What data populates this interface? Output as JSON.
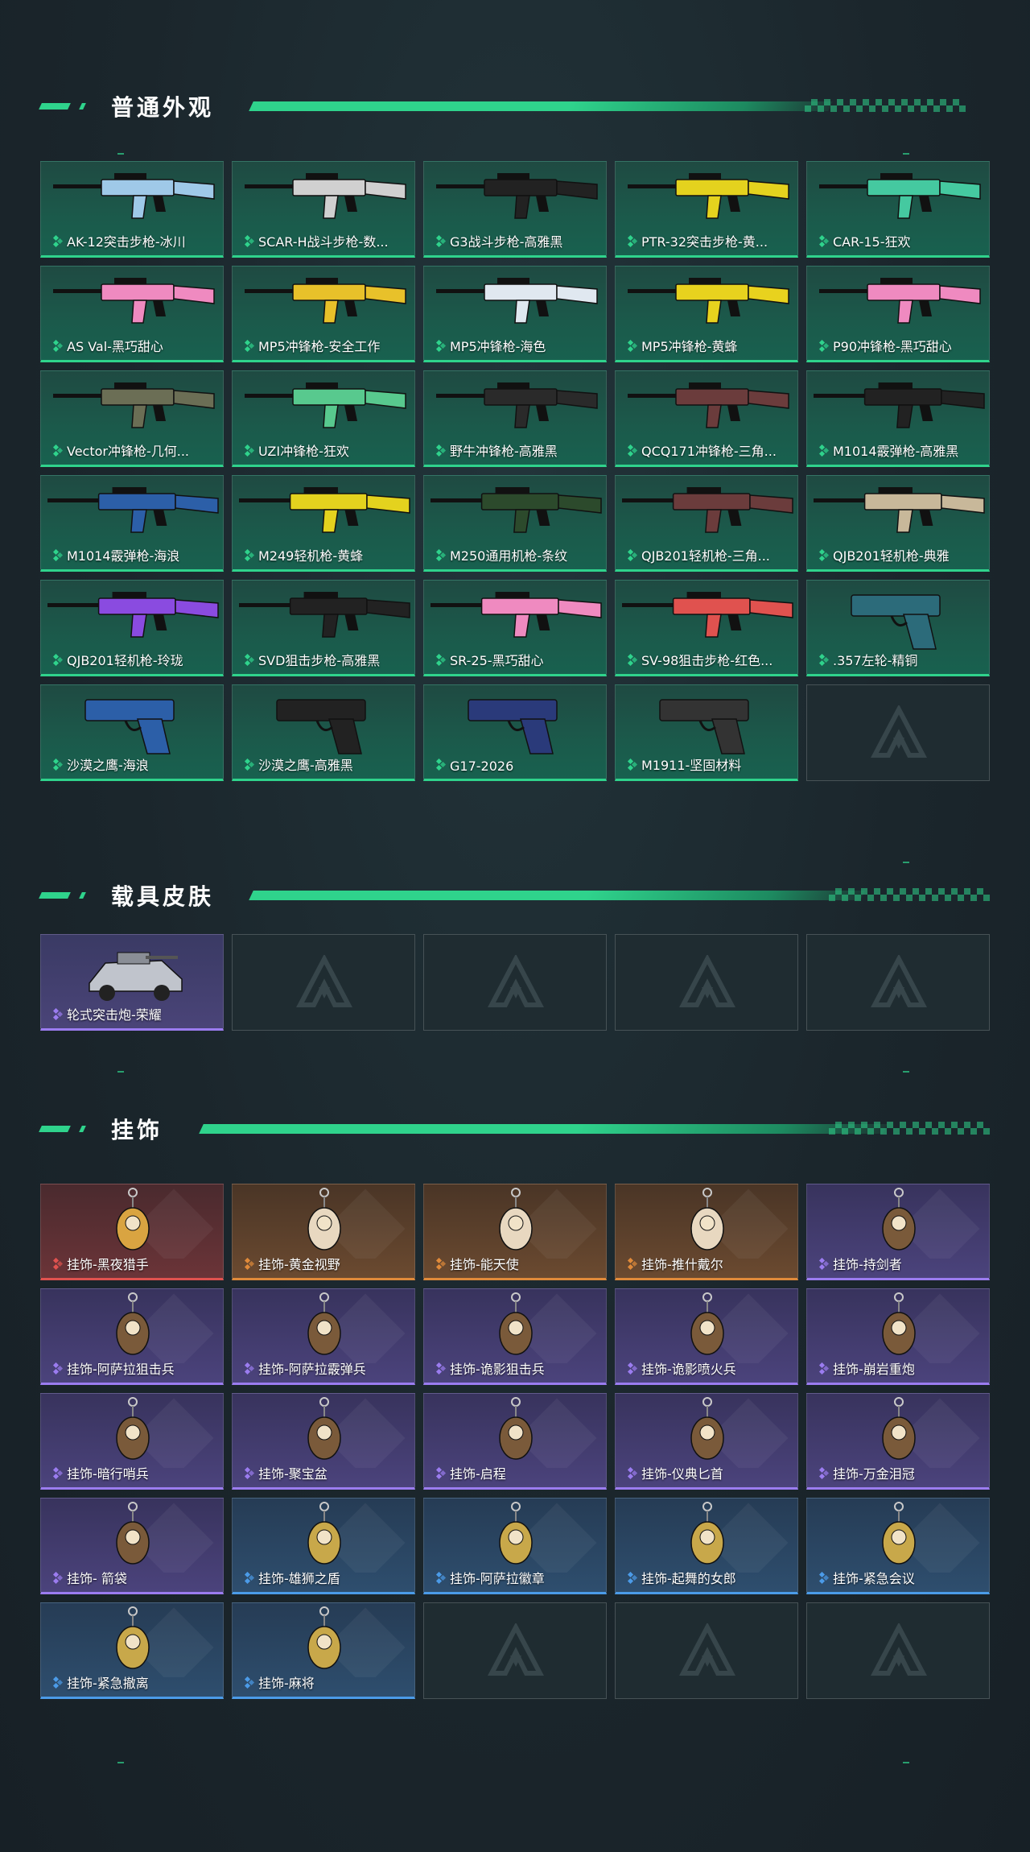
{
  "sections": {
    "weapons": {
      "title": "普通外观"
    },
    "vehicles": {
      "title": "载具皮肤"
    },
    "charms": {
      "title": "挂饰"
    }
  },
  "weapons": [
    {
      "label": "AK-12突击步枪-冰川",
      "icon": "rifle-icon",
      "color": "#9fc9e8"
    },
    {
      "label": "SCAR-H战斗步枪-数...",
      "icon": "rifle-icon",
      "color": "#d0d0d0"
    },
    {
      "label": "G3战斗步枪-高雅黑",
      "icon": "rifle-icon",
      "color": "#222222"
    },
    {
      "label": "PTR-32突击步枪-黄...",
      "icon": "rifle-icon",
      "color": "#e4d21e"
    },
    {
      "label": "CAR-15-狂欢",
      "icon": "rifle-icon",
      "color": "#45c9a0"
    },
    {
      "label": "AS Val-黑巧甜心",
      "icon": "rifle-icon",
      "color": "#ef8ac0"
    },
    {
      "label": "MP5冲锋枪-安全工作",
      "icon": "smg-icon",
      "color": "#e8c12a"
    },
    {
      "label": "MP5冲锋枪-海色",
      "icon": "smg-icon",
      "color": "#e0e8f0"
    },
    {
      "label": "MP5冲锋枪-黄蜂",
      "icon": "smg-icon",
      "color": "#e8d21e"
    },
    {
      "label": "P90冲锋枪-黑巧甜心",
      "icon": "smg-icon",
      "color": "#ef8ac0"
    },
    {
      "label": "Vector冲锋枪-几何...",
      "icon": "smg-icon",
      "color": "#6b6e55"
    },
    {
      "label": "UZI冲锋枪-狂欢",
      "icon": "smg-icon",
      "color": "#58c98e"
    },
    {
      "label": "野牛冲锋枪-高雅黑",
      "icon": "smg-icon",
      "color": "#2a2a2a"
    },
    {
      "label": "QCQ171冲锋枪-三角...",
      "icon": "smg-icon",
      "color": "#6b3c3c"
    },
    {
      "label": "M1014霰弹枪-高雅黑",
      "icon": "shotgun-icon",
      "color": "#222222"
    },
    {
      "label": "M1014霰弹枪-海浪",
      "icon": "shotgun-icon",
      "color": "#2c5fa8"
    },
    {
      "label": "M249轻机枪-黄蜂",
      "icon": "lmg-icon",
      "color": "#e4d21e"
    },
    {
      "label": "M250通用机枪-条纹",
      "icon": "lmg-icon",
      "color": "#2c4a2c"
    },
    {
      "label": "QJB201轻机枪-三角...",
      "icon": "lmg-icon",
      "color": "#6b3c3c"
    },
    {
      "label": "QJB201轻机枪-典雅",
      "icon": "lmg-icon",
      "color": "#c8b89a"
    },
    {
      "label": "QJB201轻机枪-玲珑",
      "icon": "lmg-icon",
      "color": "#8a4be0"
    },
    {
      "label": "SVD狙击步枪-高雅黑",
      "icon": "sniper-icon",
      "color": "#222222"
    },
    {
      "label": "SR-25-黑巧甜心",
      "icon": "sniper-icon",
      "color": "#ef8ac0"
    },
    {
      "label": "SV-98狙击步枪-红色...",
      "icon": "sniper-icon",
      "color": "#e0524f"
    },
    {
      "label": ".357左轮-精铜",
      "icon": "revolver-icon",
      "color": "#2c6b7a"
    },
    {
      "label": "沙漠之鹰-海浪",
      "icon": "pistol-icon",
      "color": "#2c5fa8"
    },
    {
      "label": "沙漠之鹰-高雅黑",
      "icon": "pistol-icon",
      "color": "#222222"
    },
    {
      "label": "G17-2026",
      "icon": "pistol-icon",
      "color": "#2a3a7a"
    },
    {
      "label": "M1911-坚固材料",
      "icon": "pistol-icon",
      "color": "#333333"
    }
  ],
  "vehicles": [
    {
      "label": "轮式突击炮-荣耀",
      "icon": "vehicle-icon",
      "color": "#c0c4cc"
    }
  ],
  "charms": [
    {
      "label": "挂饰-黑夜猎手",
      "rarity": "red"
    },
    {
      "label": "挂饰-黄金视野",
      "rarity": "orange"
    },
    {
      "label": "挂饰-能天使",
      "rarity": "orange"
    },
    {
      "label": "挂饰-推什戴尔",
      "rarity": "orange"
    },
    {
      "label": "挂饰-持剑者",
      "rarity": "purple"
    },
    {
      "label": "挂饰-阿萨拉狙击兵",
      "rarity": "purple"
    },
    {
      "label": "挂饰-阿萨拉霰弹兵",
      "rarity": "purple"
    },
    {
      "label": "挂饰-诡影狙击兵",
      "rarity": "purple"
    },
    {
      "label": "挂饰-诡影喷火兵",
      "rarity": "purple"
    },
    {
      "label": "挂饰-崩岩重炮",
      "rarity": "purple"
    },
    {
      "label": "挂饰-暗行哨兵",
      "rarity": "purple"
    },
    {
      "label": "挂饰-聚宝盆",
      "rarity": "purple"
    },
    {
      "label": "挂饰-启程",
      "rarity": "purple"
    },
    {
      "label": "挂饰-仪典匕首",
      "rarity": "purple"
    },
    {
      "label": "挂饰-万金泪冠",
      "rarity": "purple"
    },
    {
      "label": "挂饰- 箭袋",
      "rarity": "purple"
    },
    {
      "label": "挂饰-雄狮之盾",
      "rarity": "blue"
    },
    {
      "label": "挂饰-阿萨拉徽章",
      "rarity": "blue"
    },
    {
      "label": "挂饰-起舞的女郎",
      "rarity": "blue"
    },
    {
      "label": "挂饰-紧急会议",
      "rarity": "blue"
    },
    {
      "label": "挂饰-紧急撤离",
      "rarity": "blue"
    },
    {
      "label": "挂饰-麻将",
      "rarity": "blue"
    }
  ],
  "colors": {
    "accent": "#2fd38c",
    "red": "#e0524f",
    "orange": "#e08a3a",
    "purple": "#9b7cf0",
    "blue": "#4b9be8"
  }
}
